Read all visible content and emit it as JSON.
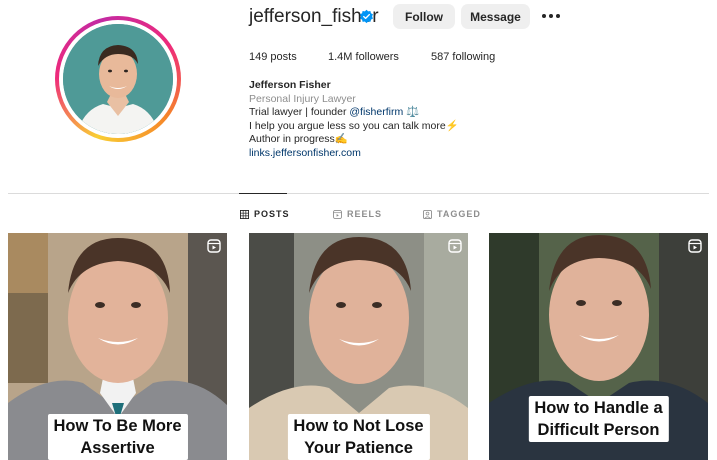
{
  "profile": {
    "username": "jefferson_fisher",
    "verified": true,
    "follow_label": "Follow",
    "message_label": "Message",
    "more_icon": "more-horizontal-icon"
  },
  "stats": {
    "posts": "149 posts",
    "followers": "1.4M followers",
    "following": "587 following"
  },
  "bio": {
    "name": "Jefferson Fisher",
    "category": "Personal Injury Lawyer",
    "line1_prefix": "Trial lawyer | founder ",
    "line1_mention": "@fisherfirm",
    "line1_suffix": " ⚖️",
    "line2": "I help you argue less so you can talk more⚡",
    "line3": "Author in progress✍️",
    "link": "links.jeffersonfisher.com"
  },
  "tabs": [
    {
      "label": "POSTS",
      "icon": "grid-icon",
      "active": true
    },
    {
      "label": "REELS",
      "icon": "reels-icon",
      "active": false
    },
    {
      "label": "TAGGED",
      "icon": "tagged-icon",
      "active": false
    }
  ],
  "posts": [
    {
      "caption_line1": "How To Be More",
      "caption_line2": "Assertive",
      "type": "reel"
    },
    {
      "caption_line1": "How to Not Lose",
      "caption_line2": "Your Patience",
      "type": "reel"
    },
    {
      "caption_line1": "How to Handle a",
      "caption_line2": "Difficult Person",
      "type": "reel"
    }
  ],
  "colors": {
    "story_ring": "#ee2a7b",
    "avatar_bg": "#4f9a97",
    "verified": "#0095f6",
    "link": "#00376b",
    "button_bg": "#efefef"
  }
}
